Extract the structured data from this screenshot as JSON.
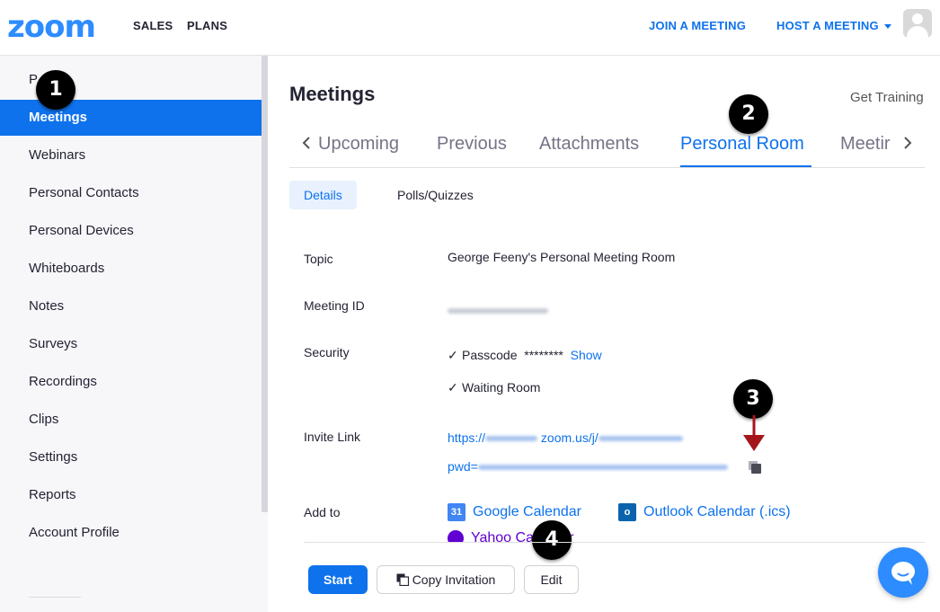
{
  "header": {
    "logo": "zoom",
    "nav": [
      "SALES",
      "PLANS"
    ],
    "join_meeting": "JOIN A MEETING",
    "host_meeting": "HOST A MEETING"
  },
  "sidebar": {
    "partial_item": "P",
    "items": [
      {
        "label": "Meetings",
        "active": true
      },
      {
        "label": "Webinars"
      },
      {
        "label": "Personal Contacts"
      },
      {
        "label": "Personal Devices"
      },
      {
        "label": "Whiteboards"
      },
      {
        "label": "Notes"
      },
      {
        "label": "Surveys"
      },
      {
        "label": "Recordings"
      },
      {
        "label": "Clips"
      },
      {
        "label": "Settings"
      },
      {
        "label": "Reports"
      },
      {
        "label": "Account Profile"
      }
    ]
  },
  "badges": [
    "1",
    "2",
    "3",
    "4"
  ],
  "main": {
    "title": "Meetings",
    "get_training": "Get Training",
    "tabs": [
      "Upcoming",
      "Previous",
      "Attachments",
      "Personal Room",
      "Meetir"
    ],
    "active_tab": "Personal Room",
    "subtabs": [
      "Details",
      "Polls/Quizzes"
    ],
    "details": {
      "topic_label": "Topic",
      "topic_value": "George Feeny's Personal Meeting Room",
      "meeting_id_label": "Meeting ID",
      "security_label": "Security",
      "passcode_label": "Passcode",
      "passcode_mask": "********",
      "show_link": "Show",
      "waiting_room": "Waiting Room",
      "invite_label": "Invite Link",
      "invite_prefix": "https://",
      "invite_domain": "zoom.us/j/",
      "invite_pwd": "pwd=",
      "add_to_label": "Add to",
      "google_calendar": "Google Calendar",
      "outlook_calendar": "Outlook Calendar (.ics)",
      "yahoo_calendar": "Yahoo Calendar"
    },
    "buttons": {
      "start": "Start",
      "copy_invitation": "Copy Invitation",
      "edit": "Edit"
    }
  },
  "colors": {
    "accent": "#0e72ed",
    "brand": "#2d8cff",
    "arrow": "#a5161a"
  }
}
